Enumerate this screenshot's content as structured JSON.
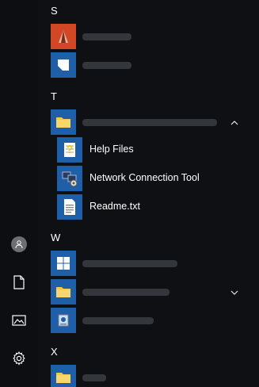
{
  "sections": {
    "s": {
      "letter": "S"
    },
    "t": {
      "letter": "T"
    },
    "w": {
      "letter": "W"
    },
    "x": {
      "letter": "X"
    }
  },
  "folder_t_children": [
    {
      "label": "Help Files",
      "icon": "help-file-icon"
    },
    {
      "label": "Network Connection Tool",
      "icon": "network-tool-icon"
    },
    {
      "label": "Readme.txt",
      "icon": "text-file-icon"
    }
  ],
  "rail": {
    "icons": [
      "user-avatar-icon",
      "documents-icon",
      "pictures-icon",
      "settings-icon"
    ]
  },
  "colors": {
    "background": "#0e1013",
    "tile_blue": "#1f5fa8",
    "tile_orange": "#d24726",
    "folder_yellow": "#f2c84b",
    "blurred_text": "#3a3e43"
  }
}
